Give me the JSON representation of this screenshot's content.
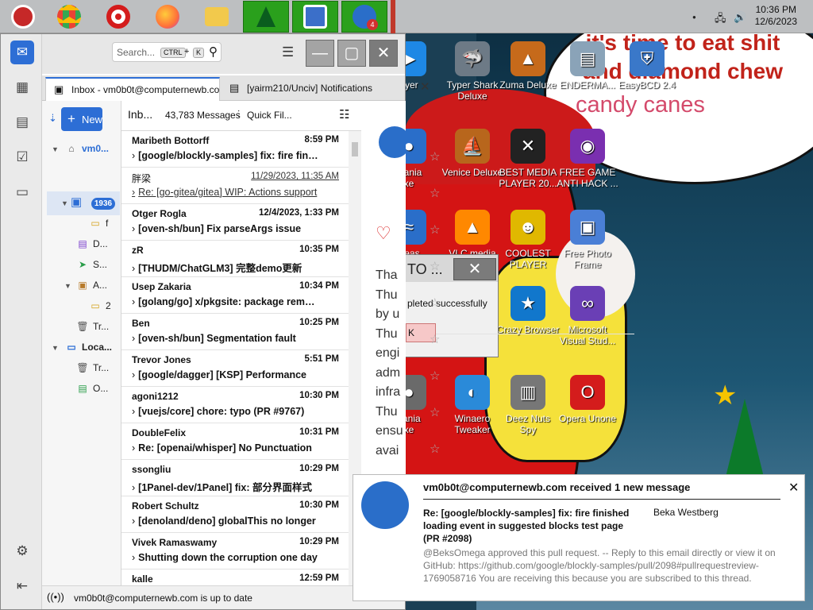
{
  "taskbar": {
    "apps": [
      {
        "name": "santa-app-icon",
        "color": "#c62828"
      },
      {
        "name": "chrome-icon",
        "color": "#34a853"
      },
      {
        "name": "opera-icon",
        "color": "#d41c1c"
      },
      {
        "name": "firefox-icon",
        "color": "#ff7139"
      },
      {
        "name": "file-explorer-icon",
        "color": "#f2c94c"
      },
      {
        "name": "christmas-tree-app-icon",
        "color": "#1b8e2e"
      },
      {
        "name": "photo-app-icon",
        "color": "#3b6fc9"
      },
      {
        "name": "thunderbird-taskbar-icon",
        "color": "#2a6ec9"
      }
    ],
    "thunderbird_badge": "4",
    "clock_time": "10:36 PM",
    "clock_date": "12/6/2023"
  },
  "window": {
    "search_placeholder": "Search...",
    "search_kbd_1": "CTRL",
    "search_plus": "+",
    "search_kbd_2": "K"
  },
  "tabs": [
    {
      "label": "Inbox - vm0b0t@computernewb.com"
    },
    {
      "label": "[yairm210/Unciv] Notifications"
    }
  ],
  "folder_pane": {
    "new_button": "New",
    "account_label": "vm0...",
    "inbox_count": "1936",
    "items": [
      "f",
      "D...",
      "S...",
      "A...",
      "2",
      "Tr...",
      "Loca...",
      "Tr...",
      "O..."
    ]
  },
  "thread_pane": {
    "folder_name": "Inb...",
    "message_count": "43,783 Messages",
    "quick_filter": "Quick Fil...",
    "messages": [
      {
        "sender": "Maribeth Bottorff",
        "date": "8:59 PM",
        "subject": "[google/blockly-samples] fix: fire finished loading event",
        "read": false
      },
      {
        "sender": "胖梁",
        "date": "11/29/2023, 11:35 AM",
        "subject": "Re: [go-gitea/gitea] WIP: Actions support",
        "read": true
      },
      {
        "sender": "Otger Rogla",
        "date": "12/4/2023, 1:33 PM",
        "subject": "[oven-sh/bun] Fix parseArgs issue",
        "read": false
      },
      {
        "sender": "zR",
        "date": "10:35 PM",
        "subject": "[THUDM/ChatGLM3] 完整demo更新",
        "read": false
      },
      {
        "sender": "Usep Zakaria",
        "date": "10:34 PM",
        "subject": "[golang/go] x/pkgsite: package removal request",
        "read": false
      },
      {
        "sender": "Ben",
        "date": "10:25 PM",
        "subject": "[oven-sh/bun] Segmentation fault",
        "read": false
      },
      {
        "sender": "Trevor Jones",
        "date": "5:51 PM",
        "subject": "[google/dagger] [KSP] Performance",
        "read": false
      },
      {
        "sender": "agoni1212",
        "date": "10:30 PM",
        "subject": "[vuejs/core] chore: typo (PR #9767)",
        "read": false
      },
      {
        "sender": "DoubleFelix",
        "date": "10:31 PM",
        "subject": "Re: [openai/whisper] No Punctuation",
        "read": false
      },
      {
        "sender": "ssongliu",
        "date": "10:29 PM",
        "subject": "[1Panel-dev/1Panel] fix: 部分界面样式",
        "read": false
      },
      {
        "sender": "Robert Schultz",
        "date": "10:30 PM",
        "subject": "[denoland/deno] globalThis no longer",
        "read": false
      },
      {
        "sender": "Vivek Ramaswamy",
        "date": "10:29 PM",
        "subject": "Shutting down the corruption one day",
        "read": false
      },
      {
        "sender": "kalle",
        "date": "12:59 PM",
        "subject": "",
        "read": false
      }
    ]
  },
  "reader": {
    "lines": "Tha\nThu\nby u\nThu\nengi\nadm\ninfra\nThu\nensu\navai"
  },
  "status_text": "vm0b0t@computernewb.com is up to date",
  "desktop": {
    "meme_line1": "it's time to eat shit",
    "meme_line2": "and diamond chew",
    "meme_line3": "candy canes",
    "icons": [
      {
        "label": "ayer",
        "glyph": "▶",
        "bg": "#1e88e5"
      },
      {
        "label": "Typer Shark Deluxe",
        "glyph": "🦈",
        "bg": "#6d7a86"
      },
      {
        "label": "Zuma Deluxe",
        "glyph": "▲",
        "bg": "#c66a1b"
      },
      {
        "label": "ENDERMA...",
        "glyph": "▤",
        "bg": "#8aa3b8"
      },
      {
        "label": "EasyBCD 2.4",
        "glyph": "⛨",
        "bg": "#3a78c9"
      },
      {
        "label": "Mania\nxe",
        "glyph": "●",
        "bg": "#2a6ec9"
      },
      {
        "label": "Venice Deluxe",
        "glyph": "⛵",
        "bg": "#b8661c"
      },
      {
        "label": "BEST MEDIA PLAYER 20...",
        "glyph": "✕",
        "bg": "#222222"
      },
      {
        "label": "FREE GAME ANTI HACK ...",
        "glyph": "◉",
        "bg": "#7a2fb0"
      },
      {
        "label": "Seas",
        "glyph": "≈",
        "bg": "#2a6ec9"
      },
      {
        "label": "VLC media",
        "glyph": "▲",
        "bg": "#ff8800"
      },
      {
        "label": "COOLEST PLAYER",
        "glyph": "☻",
        "bg": "#e0b800"
      },
      {
        "label": "Free Photo Frame",
        "glyph": "▣",
        "bg": "#4a7fd6"
      },
      {
        "label": "Crazy Browser",
        "glyph": "★",
        "bg": "#1177cc"
      },
      {
        "label": "Microsoft Visual Stud...",
        "glyph": "∞",
        "bg": "#6a3fb5"
      },
      {
        "label": "nania\nxe",
        "glyph": "●",
        "bg": "#6a6a6a"
      },
      {
        "label": "Winaero Tweaker",
        "glyph": "◐",
        "bg": "#2a8ad9"
      },
      {
        "label": "Deez Nuts Spy",
        "glyph": "▥",
        "bg": "#777777"
      },
      {
        "label": "Opera Unone",
        "glyph": "O",
        "bg": "#d41c1c"
      }
    ]
  },
  "dialog": {
    "title": "TO ...",
    "close": "✕",
    "message": "pleted successfully",
    "ok": "K"
  },
  "notification": {
    "title": "vm0b0t@computernewb.com received 1 new message",
    "subject": "Re: [google/blockly-samples] fix: fire finished loading event in suggested blocks test page (PR #2098)",
    "from": "Beka Westberg",
    "body": "@BeksOmega approved this pull request. -- Reply to this email directly or view it on GitHub: https://github.com/google/blockly-samples/pull/2098#pullrequestreview-1769058716 You are receiving this because you are subscribed to this thread."
  }
}
